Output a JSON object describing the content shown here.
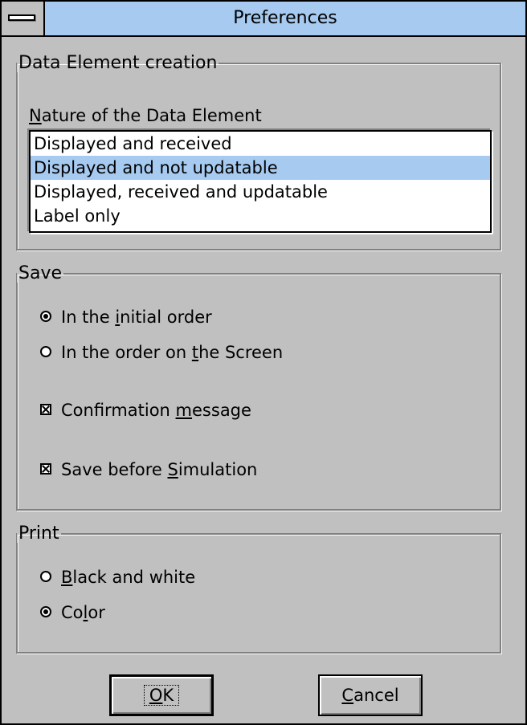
{
  "window": {
    "title": "Preferences"
  },
  "data_element": {
    "legend": "Data Element creation",
    "list_label_prefix": "",
    "list_label_key": "N",
    "list_label_rest": "ature of the Data Element",
    "items": [
      "Displayed and received",
      "Displayed and not updatable",
      "Displayed, received and updatable",
      "Label only"
    ],
    "selected_index": 1
  },
  "save": {
    "legend": "Save",
    "radio_initial": {
      "pre": "In the ",
      "key": "i",
      "post": "nitial order",
      "checked": true
    },
    "radio_screen": {
      "pre": "In the order on ",
      "key": "t",
      "post": "he Screen",
      "checked": false
    },
    "check_confirm": {
      "pre": "Confirmation ",
      "key": "m",
      "post": "essage",
      "checked": true
    },
    "check_simulation": {
      "pre": "Save before ",
      "key": "S",
      "post": "imulation",
      "checked": true
    }
  },
  "print": {
    "legend": "Print",
    "radio_bw": {
      "pre": "",
      "key": "B",
      "post": "lack and white",
      "checked": false
    },
    "radio_color": {
      "pre": "Co",
      "key": "l",
      "post": "or",
      "checked": true
    }
  },
  "buttons": {
    "ok": {
      "pre": "",
      "key": "O",
      "post": "K"
    },
    "cancel": {
      "pre": "",
      "key": "C",
      "post": "ancel"
    }
  }
}
